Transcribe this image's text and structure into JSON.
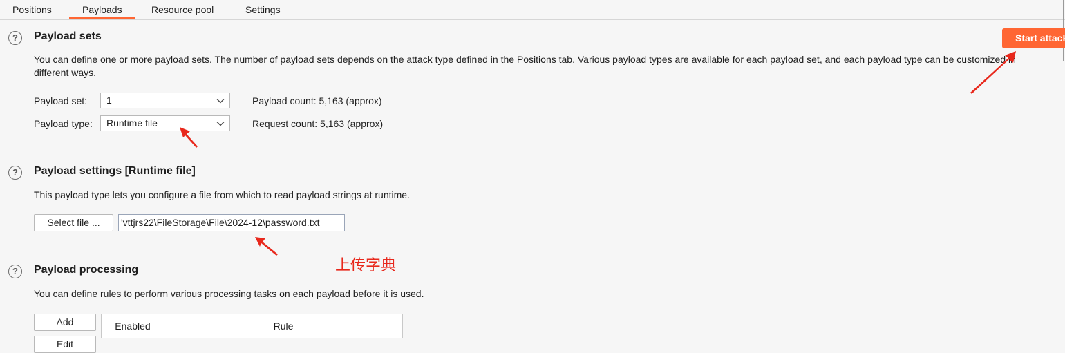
{
  "tabs": [
    "Positions",
    "Payloads",
    "Resource pool",
    "Settings"
  ],
  "start_button": "Start attack",
  "payload_sets": {
    "title": "Payload sets",
    "description": "You can define one or more payload sets. The number of payload sets depends on the attack type defined in the Positions tab. Various payload types are available for each payload set, and each payload type can be customized in different ways.",
    "set_label": "Payload set:",
    "set_value": "1",
    "type_label": "Payload type:",
    "type_value": "Runtime file",
    "payload_count": "Payload count: 5,163 (approx)",
    "request_count": "Request count: 5,163 (approx)"
  },
  "payload_settings": {
    "title": "Payload settings [Runtime file]",
    "description": "This payload type lets you configure a file from which to read payload strings at runtime.",
    "select_file": "Select file ...",
    "file_path": "'vttjrs22\\FileStorage\\File\\2024-12\\password.txt"
  },
  "annotation": "上传字典",
  "payload_processing": {
    "title": "Payload processing",
    "description": "You can define rules to perform various processing tasks on each payload before it is used.",
    "add": "Add",
    "edit": "Edit",
    "columns": [
      "Enabled",
      "Rule"
    ]
  },
  "colors": {
    "accent": "#ff6633",
    "annotation": "#e8281c"
  },
  "icons": [
    "help-icon",
    "chevron-down-icon"
  ]
}
